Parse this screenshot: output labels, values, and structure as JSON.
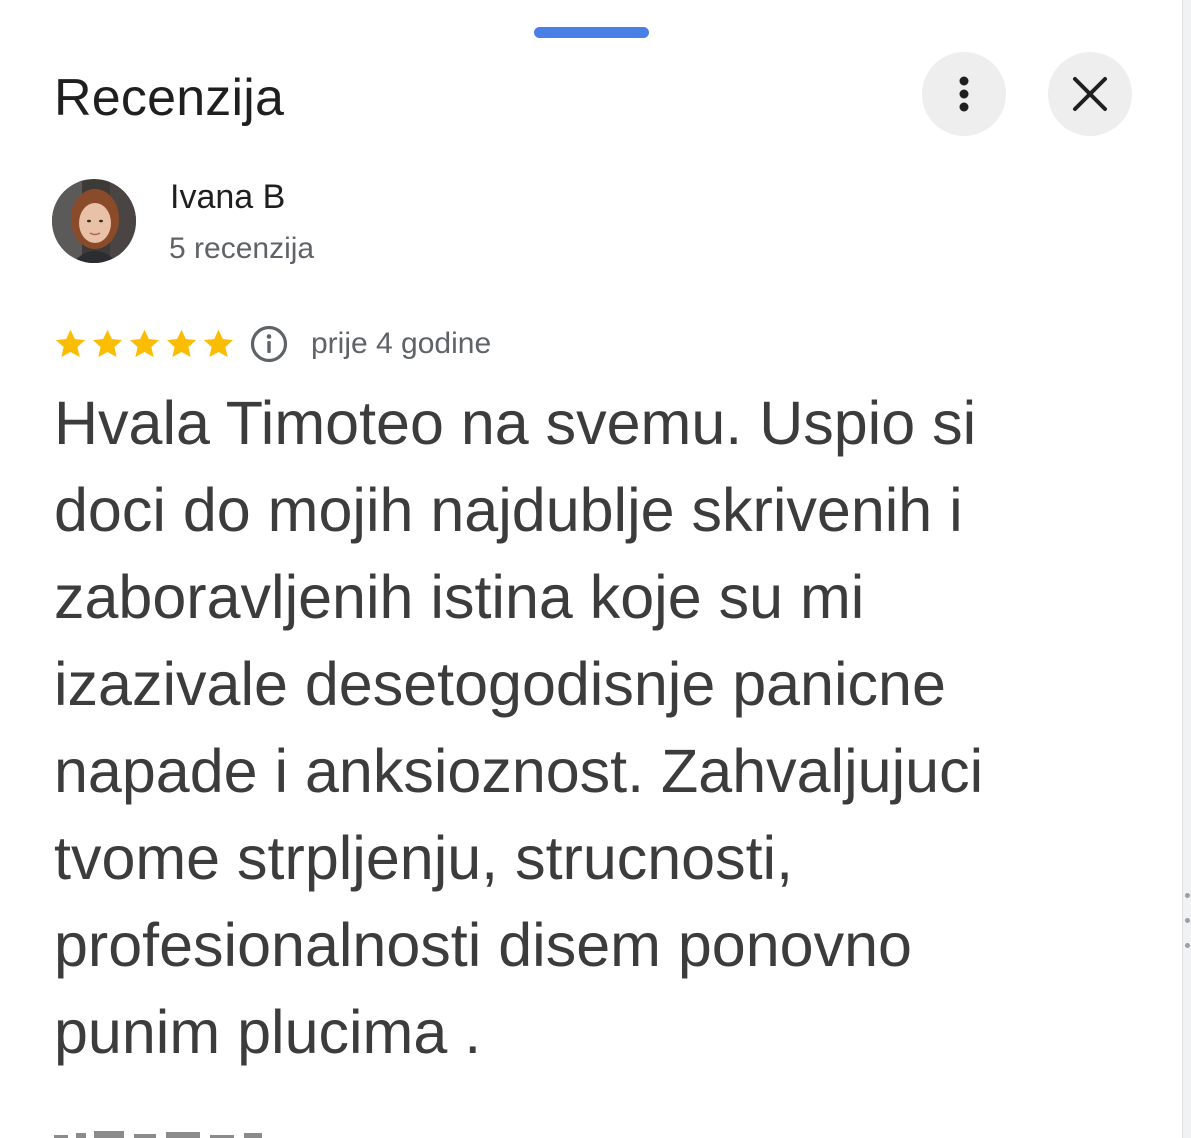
{
  "header": {
    "title": "Recenzija",
    "more_icon": "more-vert-icon",
    "close_icon": "close-icon"
  },
  "reviewer": {
    "name": "Ivana B",
    "review_count": "5 recenzija"
  },
  "rating": {
    "stars": 5,
    "max_stars": 5,
    "time": "prije 4 godine",
    "info_icon": "info-icon"
  },
  "review": {
    "text": "Hvala Timoteo na svemu. Uspio si doci do mojih najdublje skrivenih i zaboravljenih istina koje su mi izazivale desetogodisnje panicne napade i anksioznost. Zahvaljujuci tvome strpljenju, strucnosti, profesionalnosti disem ponovno punim plucima ."
  },
  "colors": {
    "accent": "#4a7fe6",
    "star": "#fbbc04",
    "button_bg": "#eeeeee",
    "secondary_text": "#5f6368"
  }
}
